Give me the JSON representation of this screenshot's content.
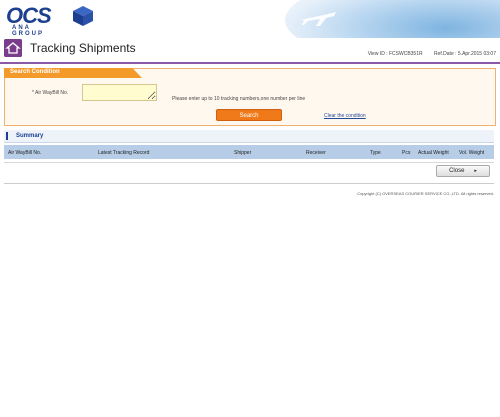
{
  "header": {
    "logo_text": "OCS",
    "logo_sub": "ANA GROUP"
  },
  "titlebar": {
    "title": "Tracking Shipments",
    "view_id": "View ID : FCSWCB351R",
    "ref_date": "Ref.Date : 5.Apr.2015 03:07"
  },
  "search": {
    "tab_label": "Search Condition",
    "awb_label": "* Air WayBill No.",
    "awb_value": "",
    "hint": "Please enter up to 10 tracking numbers,one number per line",
    "search_button": "Search",
    "clear_link": "Clear the condition"
  },
  "summary": {
    "title": "Summary",
    "columns": [
      "Air WayBill No.",
      "Latest Tracking Record",
      "Shipper",
      "Receiver",
      "Type",
      "Pcs",
      "Actual Weight",
      "Vol. Weight"
    ]
  },
  "footer": {
    "close_button": "Close",
    "copyright": "Copyright (C) OVERSEAS COURIER SERVICE CO.,LTD. All rights reserved."
  },
  "colors": {
    "brand_blue": "#1d3f8f",
    "accent_orange": "#f07a1a",
    "title_purple": "#7a3d8c"
  }
}
